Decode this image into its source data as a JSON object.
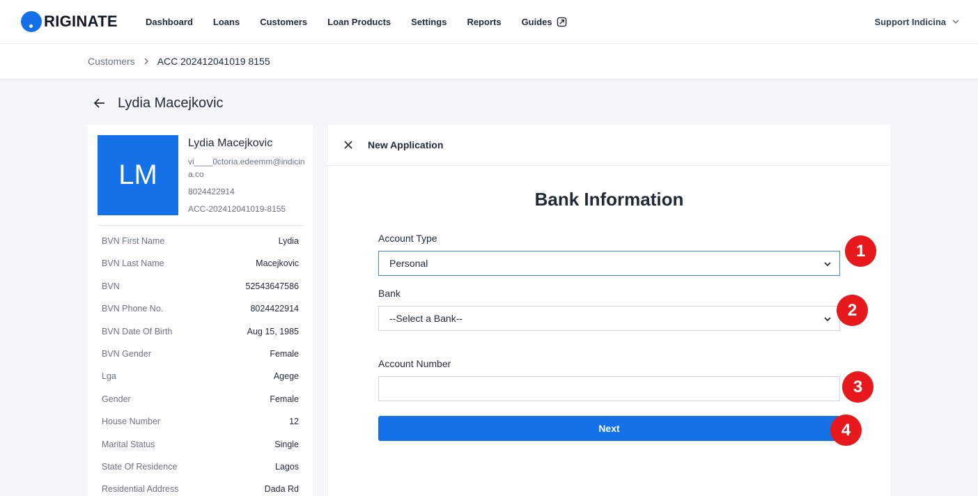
{
  "brand": {
    "logo_text": "RIGINATE",
    "accent": "#1471e8"
  },
  "nav": {
    "items": [
      {
        "label": "Dashboard"
      },
      {
        "label": "Loans"
      },
      {
        "label": "Customers"
      },
      {
        "label": "Loan Products"
      },
      {
        "label": "Settings"
      },
      {
        "label": "Reports"
      },
      {
        "label": "Guides",
        "icon": "external-link-icon"
      }
    ],
    "user": "Support Indicina"
  },
  "breadcrumb": {
    "parent": "Customers",
    "current": "ACC 202412041019 8155"
  },
  "page": {
    "title": "Lydia Macejkovic"
  },
  "profile": {
    "initials": "LM",
    "name": "Lydia Macejkovic",
    "email": "vi____0ctoria.edeemm@indicina.co",
    "phone": "8024422914",
    "account": "ACC-202412041019-8155",
    "details": [
      {
        "label": "BVN First Name",
        "value": "Lydia"
      },
      {
        "label": "BVN Last Name",
        "value": "Macejkovic"
      },
      {
        "label": "BVN",
        "value": "52543647586"
      },
      {
        "label": "BVN Phone No.",
        "value": "8024422914"
      },
      {
        "label": "BVN Date Of Birth",
        "value": "Aug 15, 1985"
      },
      {
        "label": "BVN Gender",
        "value": "Female"
      },
      {
        "label": "Lga",
        "value": "Agege"
      },
      {
        "label": "Gender",
        "value": "Female"
      },
      {
        "label": "House Number",
        "value": "12"
      },
      {
        "label": "Marital Status",
        "value": "Single"
      },
      {
        "label": "State Of Residence",
        "value": "Lagos"
      },
      {
        "label": "Residential Address",
        "value": "Dada Rd"
      }
    ]
  },
  "application": {
    "title": "New Application",
    "heading": "Bank Information",
    "account_type": {
      "label": "Account Type",
      "value": "Personal"
    },
    "bank": {
      "label": "Bank",
      "value": "--Select a Bank--"
    },
    "account_number": {
      "label": "Account Number",
      "value": "",
      "placeholder": ""
    },
    "next_label": "Next"
  },
  "markers": [
    "1",
    "2",
    "3",
    "4"
  ],
  "colors": {
    "marker": "#e8191c",
    "focus_border": "#3b82f6"
  }
}
